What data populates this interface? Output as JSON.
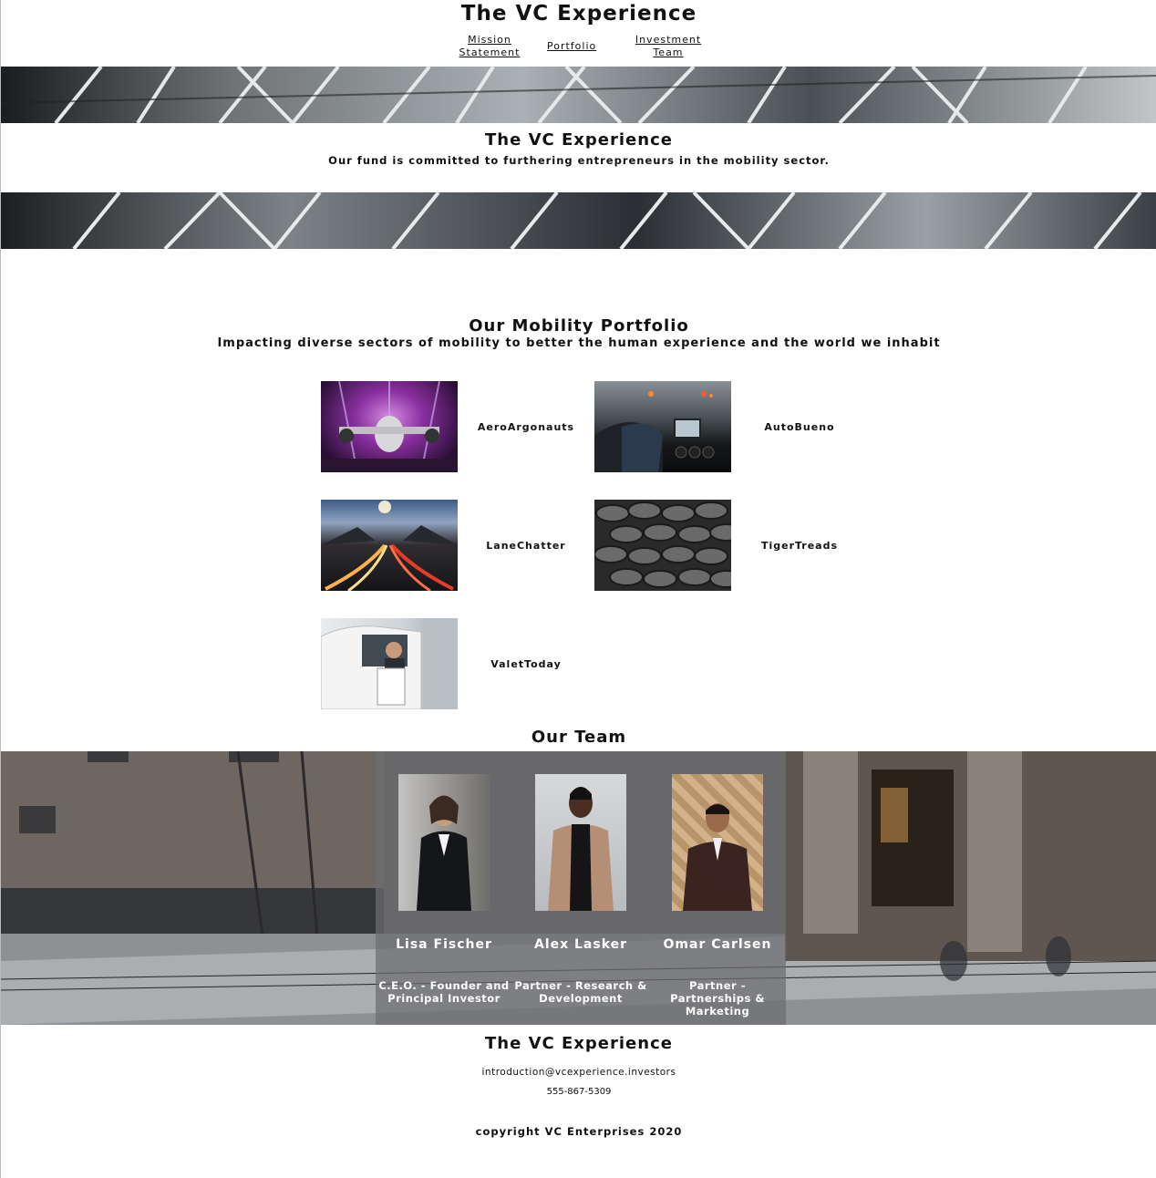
{
  "header": {
    "title": "The VC Experience",
    "nav": [
      "Mission Statement",
      "Portfolio",
      "Investment Team"
    ]
  },
  "hero": {
    "title": "The VC Experience",
    "subtitle": "Our fund is committed to furthering entrepreneurs in the mobility sector."
  },
  "portfolio": {
    "title": "Our Mobility Portfolio",
    "subtitle": "Impacting diverse sectors of mobility to better the human experience and the world we inhabit",
    "items": [
      "AeroArgonauts",
      "AutoBueno",
      "LaneChatter",
      "TigerTreads",
      "ValetToday"
    ]
  },
  "team": {
    "title": "Our Team",
    "members": [
      {
        "name": "Lisa Fischer",
        "role": "C.E.O. - Founder and Principal Investor"
      },
      {
        "name": "Alex Lasker",
        "role": "Partner - Research & Development"
      },
      {
        "name": "Omar Carlsen",
        "role": "Partner - Partnerships & Marketing"
      }
    ]
  },
  "footer": {
    "title": "The VC Experience",
    "email": "introduction@vcexperience.investors",
    "phone": "555-867-5309",
    "copyright": "copyright VC Enterprises 2020"
  }
}
